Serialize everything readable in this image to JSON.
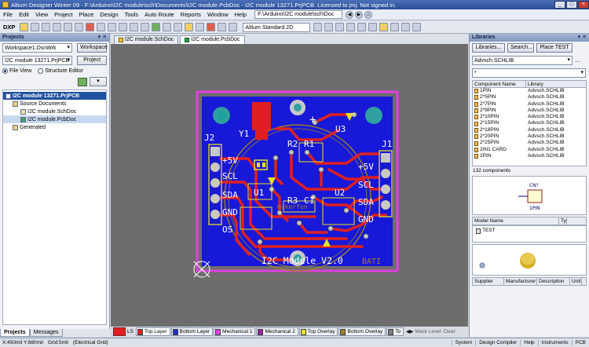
{
  "window": {
    "title": "Altium Designer Winter 09 - F:\\Arduino\\I2C module\\sch\\Documents\\I2C module.PcbDoc - I2C module 13271.PrjPCB. Licensed to jmj. Not signed in."
  },
  "menu": {
    "items": [
      "File",
      "Edit",
      "View",
      "Project",
      "Place",
      "Design",
      "Tools",
      "Auto Route",
      "Reports",
      "Window",
      "Help"
    ],
    "path": "F:\\Arduino\\I2C module\\sch\\Doc"
  },
  "toolbar": {
    "dxp_label": "DXP",
    "view_mode": "Altium Standard 2D"
  },
  "projects_panel": {
    "title": "Projects",
    "workspace": "Workspace1.DsnWrk",
    "workspace_button": "Workspace",
    "project": "I2C module 13271.PrjPCB",
    "project_button": "Project",
    "file_view": "File View",
    "structure_editor": "Structure Editor",
    "tree": {
      "project": "I2C module 13271.PrjPCB",
      "source_documents": "Source Documents",
      "schdoc": "I2C module.SchDoc",
      "pcbdoc": "I2C module.PcbDoc",
      "generated": "Generated"
    },
    "bottom_tabs": [
      "Projects",
      "Messages"
    ]
  },
  "doc_tabs": [
    "I2C module.SchDoc",
    "I2C module.PcbDoc"
  ],
  "pcb": {
    "labels": {
      "J2": "J2",
      "J1": "J1",
      "Y1": "Y1",
      "U3": "U3",
      "U1": "U1",
      "U2": "U2",
      "R2": "R2",
      "R1": "R1",
      "R3": "R3",
      "C1": "C1",
      "left_5v": "+5V",
      "left_scl": "SCL",
      "left_sda": "SDA",
      "left_gnd": "GND",
      "left_os": "OS",
      "right_5v": "+5V",
      "right_scl": "SCL",
      "right_sda": "SDA",
      "right_gnd": "GND",
      "plus": "+",
      "module": "I2C Module V2.0",
      "bati": "BATI",
      "mirrored": "makerfun"
    }
  },
  "layer_tabs": {
    "ls": "LS",
    "items": [
      {
        "name": "Top Layer",
        "color": "#e02020"
      },
      {
        "name": "Bottom Layer",
        "color": "#2030d0"
      },
      {
        "name": "Mechanical 1",
        "color": "#e040e0"
      },
      {
        "name": "Mechanical 2",
        "color": "#a020a0"
      },
      {
        "name": "Top Overlay",
        "color": "#e8e020"
      },
      {
        "name": "Bottom Overlay",
        "color": "#a08020"
      },
      {
        "name": "To",
        "color": "#808080"
      }
    ],
    "mask_level": "Mask Level",
    "clear": "Clear"
  },
  "libraries_panel": {
    "title": "Libraries",
    "buttons": [
      "Libraries...",
      "Search...",
      "Place TEST"
    ],
    "selected_lib": "Advsch.SCHLIB",
    "filter": "*",
    "col_component": "Component Name",
    "col_library": "Library",
    "rows": [
      {
        "name": "1PIN",
        "lib": "Advsch.SCHLIB"
      },
      {
        "name": "2*5PIN",
        "lib": "Advsch.SCHLIB"
      },
      {
        "name": "2*7PIN",
        "lib": "Advsch.SCHLIB"
      },
      {
        "name": "2*9PIN",
        "lib": "Advsch.SCHLIB"
      },
      {
        "name": "2*10PIN",
        "lib": "Advsch.SCHLIB"
      },
      {
        "name": "2*15PIN",
        "lib": "Advsch.SCHLIB"
      },
      {
        "name": "2*18PIN",
        "lib": "Advsch.SCHLIB"
      },
      {
        "name": "2*20PIN",
        "lib": "Advsch.SCHLIB"
      },
      {
        "name": "2*25PIN",
        "lib": "Advsch.SCHLIB"
      },
      {
        "name": "2IN1 CARD",
        "lib": "Advsch.SCHLIB"
      },
      {
        "name": "2PIN",
        "lib": "Advsch.SCHLIB"
      }
    ],
    "count": "132 components",
    "symbol_ref": "CN?",
    "symbol_value": "1PIN",
    "model_name_hdr": "Model Name",
    "model_type_hdr": "Ty",
    "model": "TEST",
    "supplier_cols": [
      "Supplier",
      "Manufacturer",
      "Description",
      "Unit"
    ]
  },
  "status": {
    "coords": "X:450mil Y:880mil",
    "grid": "Grid:5mil",
    "grid_type": "(Electrical Grid)",
    "right": [
      "System",
      "Design Compiler",
      "Help",
      "Instruments",
      "PCB"
    ]
  }
}
